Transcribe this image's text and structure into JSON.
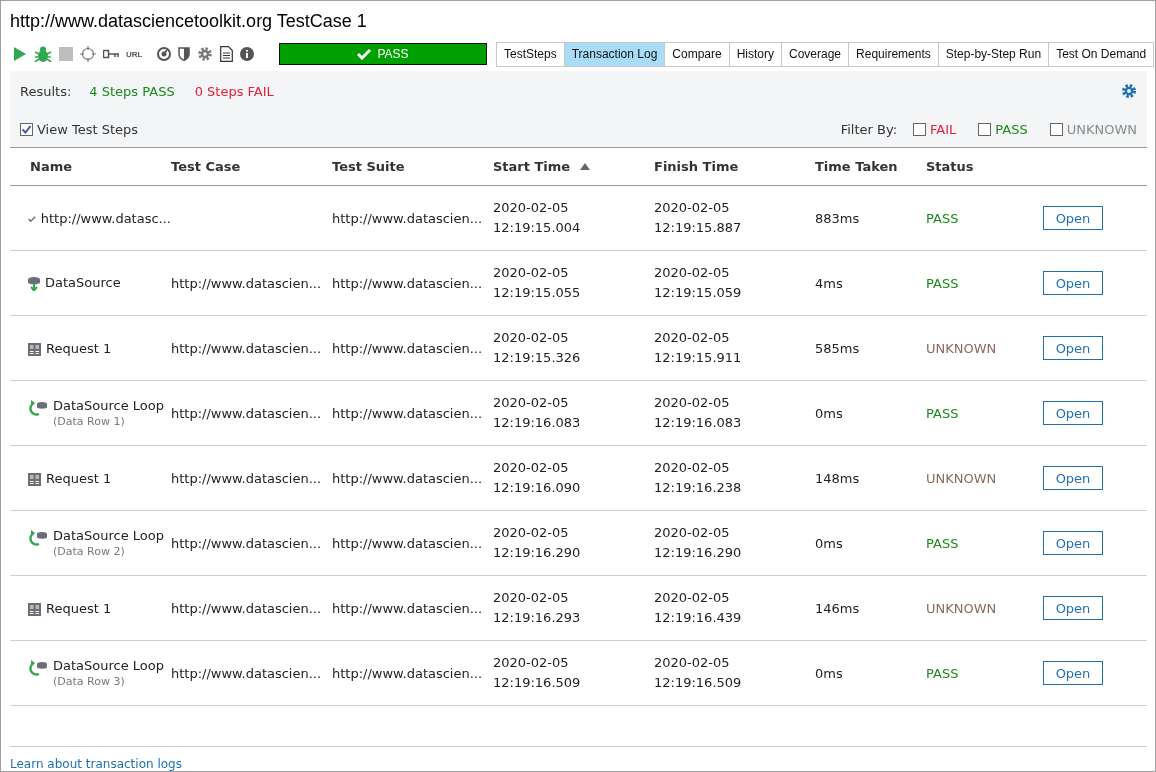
{
  "window": {
    "title": "http://www.datasciencetoolkit.org TestCase 1"
  },
  "toolbar": {
    "url_label": "URL",
    "result": {
      "text": "PASS",
      "kind": "pass"
    }
  },
  "tabs": [
    {
      "label": "TestSteps",
      "selected": false
    },
    {
      "label": "Transaction Log",
      "selected": true
    },
    {
      "label": "Compare",
      "selected": false
    },
    {
      "label": "History",
      "selected": false
    },
    {
      "label": "Coverage",
      "selected": false
    },
    {
      "label": "Requirements",
      "selected": false
    },
    {
      "label": "Step-by-Step Run",
      "selected": false
    },
    {
      "label": "Test On Demand",
      "selected": false
    }
  ],
  "results": {
    "label": "Results:",
    "items": [
      {
        "text": "4 Steps PASS",
        "kind": "pass"
      },
      {
        "text": "0 Steps FAIL",
        "kind": "fail"
      }
    ]
  },
  "view_test_steps": {
    "label": "View Test Steps",
    "checked": true
  },
  "filter": {
    "label": "Filter By:",
    "options": [
      {
        "label": "FAIL",
        "kind": "fail",
        "checked": false
      },
      {
        "label": "PASS",
        "kind": "pass",
        "checked": false
      },
      {
        "label": "UNKNOWN",
        "kind": "unknown",
        "checked": false
      }
    ]
  },
  "table": {
    "columns": [
      {
        "label": "Name"
      },
      {
        "label": "Test Case"
      },
      {
        "label": "Test Suite"
      },
      {
        "label": "Start Time",
        "sorted_ascending": true
      },
      {
        "label": "Finish Time"
      },
      {
        "label": "Time Taken"
      },
      {
        "label": "Status"
      }
    ],
    "rows": [
      {
        "kind": "check",
        "name": "http://www.datasc...",
        "test_case": "",
        "test_suite": "http://www.datascien...",
        "start": [
          "2020-02-05",
          "12:19:15.004"
        ],
        "finish": [
          "2020-02-05",
          "12:19:15.887"
        ],
        "time": "883ms",
        "status": {
          "text": "PASS",
          "kind": "pass"
        },
        "action": "Open"
      },
      {
        "kind": "datasource",
        "name": "DataSource",
        "test_case": "http://www.datascien...",
        "test_suite": "http://www.datascien...",
        "start": [
          "2020-02-05",
          "12:19:15.055"
        ],
        "finish": [
          "2020-02-05",
          "12:19:15.059"
        ],
        "time": "4ms",
        "status": {
          "text": "PASS",
          "kind": "pass"
        },
        "action": "Open"
      },
      {
        "kind": "rest",
        "name": "Request 1",
        "test_case": "http://www.datascien...",
        "test_suite": "http://www.datascien...",
        "start": [
          "2020-02-05",
          "12:19:15.326"
        ],
        "finish": [
          "2020-02-05",
          "12:19:15.911"
        ],
        "time": "585ms",
        "status": {
          "text": "UNKNOWN",
          "kind": "unknown"
        },
        "action": "Open"
      },
      {
        "kind": "loop",
        "name": "DataSource Loop",
        "detail": "(Data Row 1)",
        "test_case": "http://www.datascien...",
        "test_suite": "http://www.datascien...",
        "start": [
          "2020-02-05",
          "12:19:16.083"
        ],
        "finish": [
          "2020-02-05",
          "12:19:16.083"
        ],
        "time": "0ms",
        "status": {
          "text": "PASS",
          "kind": "pass"
        },
        "action": "Open"
      },
      {
        "kind": "rest",
        "name": "Request 1",
        "test_case": "http://www.datascien...",
        "test_suite": "http://www.datascien...",
        "start": [
          "2020-02-05",
          "12:19:16.090"
        ],
        "finish": [
          "2020-02-05",
          "12:19:16.238"
        ],
        "time": "148ms",
        "status": {
          "text": "UNKNOWN",
          "kind": "unknown"
        },
        "action": "Open"
      },
      {
        "kind": "loop",
        "name": "DataSource Loop",
        "detail": "(Data Row 2)",
        "test_case": "http://www.datascien...",
        "test_suite": "http://www.datascien...",
        "start": [
          "2020-02-05",
          "12:19:16.290"
        ],
        "finish": [
          "2020-02-05",
          "12:19:16.290"
        ],
        "time": "0ms",
        "status": {
          "text": "PASS",
          "kind": "pass"
        },
        "action": "Open"
      },
      {
        "kind": "rest",
        "name": "Request 1",
        "test_case": "http://www.datascien...",
        "test_suite": "http://www.datascien...",
        "start": [
          "2020-02-05",
          "12:19:16.293"
        ],
        "finish": [
          "2020-02-05",
          "12:19:16.439"
        ],
        "time": "146ms",
        "status": {
          "text": "UNKNOWN",
          "kind": "unknown"
        },
        "action": "Open"
      },
      {
        "kind": "loop",
        "name": "DataSource Loop",
        "detail": "(Data Row 3)",
        "test_case": "http://www.datascien...",
        "test_suite": "http://www.datascien...",
        "start": [
          "2020-02-05",
          "12:19:16.509"
        ],
        "finish": [
          "2020-02-05",
          "12:19:16.509"
        ],
        "time": "0ms",
        "status": {
          "text": "PASS",
          "kind": "pass"
        },
        "action": "Open"
      }
    ]
  },
  "footer_link": "Learn about transaction logs"
}
